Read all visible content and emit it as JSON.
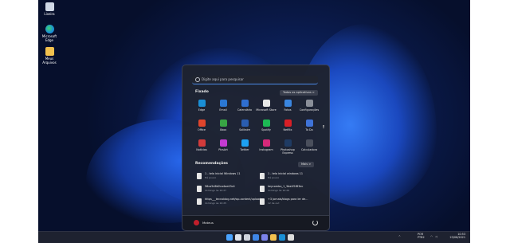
{
  "desktop": {
    "icons": [
      {
        "label": "Lixeira",
        "icon": "recycle-bin-icon"
      },
      {
        "label": "Microsoft Edge",
        "icon": "edge-icon"
      },
      {
        "label": "Meus Arquivos",
        "icon": "folder-icon"
      }
    ]
  },
  "start_menu": {
    "search_placeholder": "Digite aqui para pesquisar",
    "pinned_title": "Fixado",
    "all_apps_label": "Todos os aplicativos  >",
    "pinned_apps": [
      {
        "label": "Edge",
        "color": "#1a8fd6"
      },
      {
        "label": "Email",
        "color": "#2b78d4"
      },
      {
        "label": "Calendário",
        "color": "#2f6fd1"
      },
      {
        "label": "Microsoft Store",
        "color": "#e8e8e8"
      },
      {
        "label": "Fotos",
        "color": "#3a86e0"
      },
      {
        "label": "Configurações",
        "color": "#8a8f99"
      },
      {
        "label": "Office",
        "color": "#e0452c"
      },
      {
        "label": "Xbox",
        "color": "#38a544"
      },
      {
        "label": "Solitaire",
        "color": "#2a5db0"
      },
      {
        "label": "Spotify",
        "color": "#1db954"
      },
      {
        "label": "Netflix",
        "color": "#d81f26"
      },
      {
        "label": "To Do",
        "color": "#3f73d8"
      },
      {
        "label": "Notícias",
        "color": "#d23b3b"
      },
      {
        "label": "PicsArt",
        "color": "#c43ad1"
      },
      {
        "label": "Twitter",
        "color": "#1da1f2"
      },
      {
        "label": "Instagram",
        "color": "#d6297a"
      },
      {
        "label": "Photoshop Express",
        "color": "#1f3b63"
      },
      {
        "label": "Calculadora",
        "color": "#4a4f5c"
      }
    ],
    "recommended_title": "Recomendações",
    "more_label": "Mais  >",
    "recommended": [
      {
        "title": "1 - tela inicial Windows 11",
        "sub": "Há pouco"
      },
      {
        "title": "1 - tela inicial windows 11",
        "sub": "Há pouco"
      },
      {
        "title": "56ca5d8d2ca4ae43c4",
        "sub": "domingo às 10:27"
      },
      {
        "title": "keycombo_1_3da4f1f83ec",
        "sub": "domingo às 10:26"
      },
      {
        "title": "https___tecnoblog.net/wp-content/uploads...",
        "sub": "domingo às 10:25"
      },
      {
        "title": "+3 jornais/blogs para ler de...",
        "sub": "12 de out"
      }
    ],
    "user_name": "Mateus"
  },
  "taskbar": {
    "apps": [
      {
        "name": "start-icon",
        "color": "#4aa3ff"
      },
      {
        "name": "search-icon",
        "color": "#dfe3ea"
      },
      {
        "name": "task-view-icon",
        "color": "#cfd4de"
      },
      {
        "name": "widgets-icon",
        "color": "#3f86e6"
      },
      {
        "name": "chat-icon",
        "color": "#7b83eb"
      },
      {
        "name": "file-explorer-icon",
        "color": "#f2c14e"
      },
      {
        "name": "edge-icon",
        "color": "#1a8fd6"
      },
      {
        "name": "store-icon",
        "color": "#dcdcdc"
      }
    ],
    "lang": "POR",
    "lang2": "PTB2",
    "time": "10:53",
    "date": "23/08/2021"
  }
}
